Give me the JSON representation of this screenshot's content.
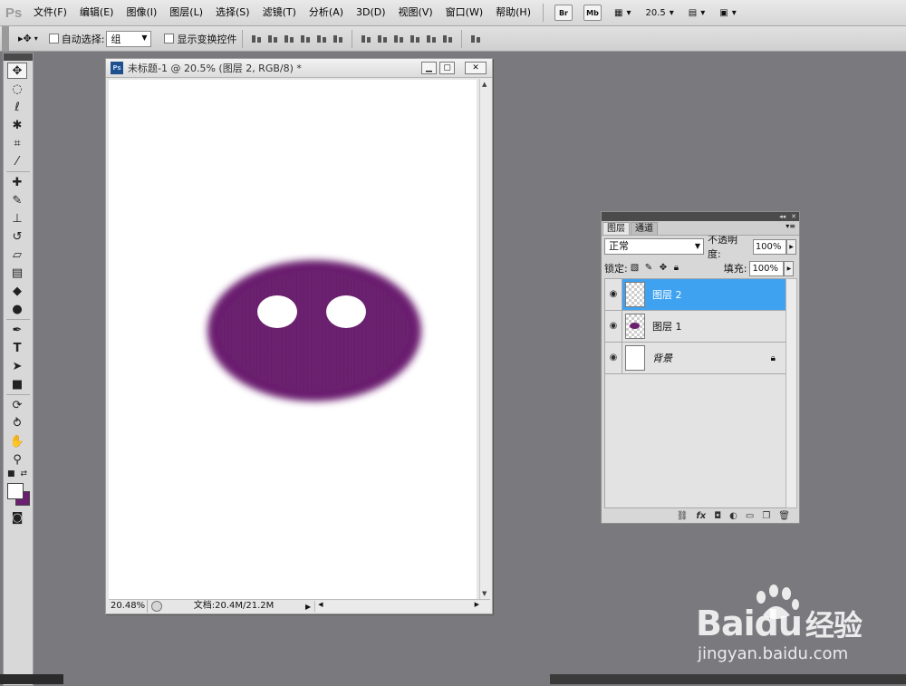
{
  "app": {
    "logo": "Ps",
    "menus": [
      "文件(F)",
      "编辑(E)",
      "图像(I)",
      "图层(L)",
      "选择(S)",
      "滤镜(T)",
      "分析(A)",
      "3D(D)",
      "视图(V)",
      "窗口(W)",
      "帮助(H)"
    ],
    "bridge_label": "Br",
    "minibridge_label": "Mb",
    "zoom_value": "20.5"
  },
  "options": {
    "auto_select_label": "自动选择:",
    "auto_select_value": "组",
    "show_transform_label": "显示变换控件"
  },
  "document": {
    "title": "未标题-1 @ 20.5% (图层 2, RGB/8) *",
    "zoom": "20.48%",
    "doc_info": "文档:20.4M/21.2M",
    "ellipse_color": "#6a1c6e",
    "eye_color": "#ffffff"
  },
  "tools": {
    "foreground_color": "#ffffff",
    "background_color": "#6c1f70"
  },
  "layers_panel": {
    "tabs": [
      "图层",
      "通道"
    ],
    "blend_mode": "正常",
    "opacity_label": "不透明度:",
    "opacity_value": "100%",
    "lock_label": "锁定:",
    "fill_label": "填充:",
    "fill_value": "100%",
    "layers": [
      {
        "name": "图层 2",
        "selected": true
      },
      {
        "name": "图层 1",
        "selected": false
      },
      {
        "name": "背景",
        "selected": false,
        "locked": true
      }
    ],
    "footer_icons": [
      "link-icon",
      "fx-icon",
      "mask-icon",
      "adjustment-icon",
      "group-icon",
      "new-layer-icon",
      "trash-icon"
    ]
  },
  "watermark": {
    "brand_bai": "Bai",
    "brand_du": "du",
    "brand_cn": "经验",
    "url": "jingyan.baidu.com"
  }
}
